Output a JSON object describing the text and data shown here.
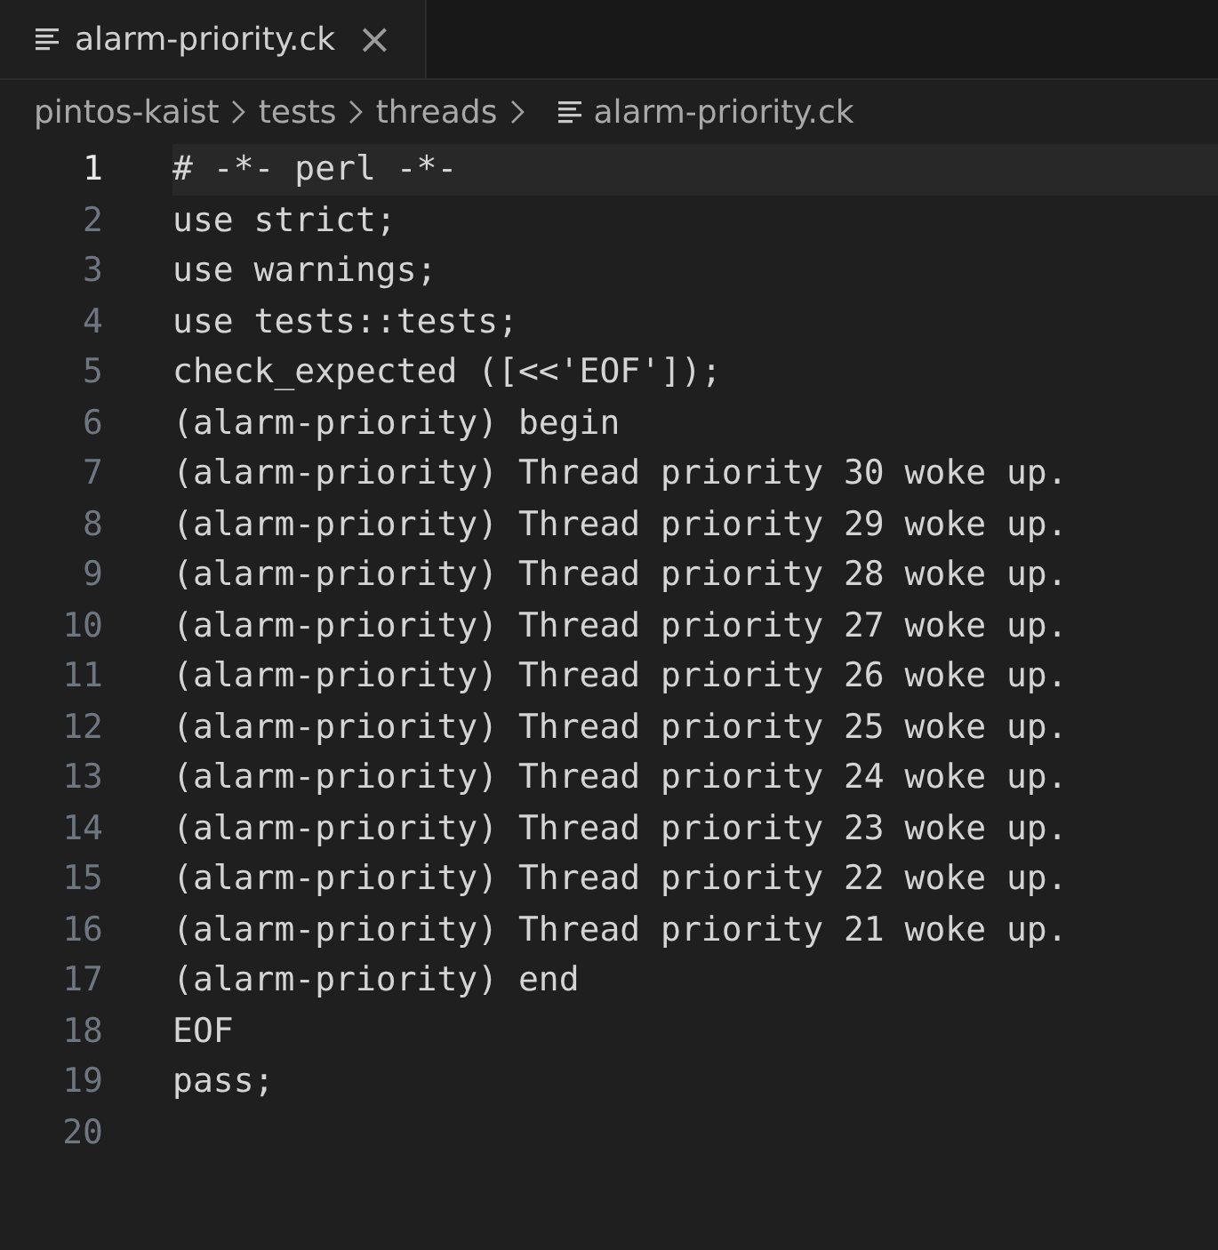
{
  "tabs": [
    {
      "label": "alarm-priority.ck",
      "close": "×",
      "selected": true
    }
  ],
  "breadcrumb": {
    "segments": [
      "pintos-kaist",
      "tests",
      "threads"
    ],
    "file": "alarm-priority.ck"
  },
  "lines": [
    {
      "number": "1",
      "code": "# -*- perl -*-",
      "selected": true
    },
    {
      "number": "2",
      "code": "use strict;",
      "selected": false
    },
    {
      "number": "3",
      "code": "use warnings;",
      "selected": false
    },
    {
      "number": "4",
      "code": "use tests::tests;",
      "selected": false
    },
    {
      "number": "5",
      "code": "check_expected ([<<'EOF']);",
      "selected": false
    },
    {
      "number": "6",
      "code": "(alarm-priority) begin",
      "selected": false
    },
    {
      "number": "7",
      "code": "(alarm-priority) Thread priority 30 woke up.",
      "selected": false
    },
    {
      "number": "8",
      "code": "(alarm-priority) Thread priority 29 woke up.",
      "selected": false
    },
    {
      "number": "9",
      "code": "(alarm-priority) Thread priority 28 woke up.",
      "selected": false
    },
    {
      "number": "10",
      "code": "(alarm-priority) Thread priority 27 woke up.",
      "selected": false
    },
    {
      "number": "11",
      "code": "(alarm-priority) Thread priority 26 woke up.",
      "selected": false
    },
    {
      "number": "12",
      "code": "(alarm-priority) Thread priority 25 woke up.",
      "selected": false
    },
    {
      "number": "13",
      "code": "(alarm-priority) Thread priority 24 woke up.",
      "selected": false
    },
    {
      "number": "14",
      "code": "(alarm-priority) Thread priority 23 woke up.",
      "selected": false
    },
    {
      "number": "15",
      "code": "(alarm-priority) Thread priority 22 woke up.",
      "selected": false
    },
    {
      "number": "16",
      "code": "(alarm-priority) Thread priority 21 woke up.",
      "selected": false
    },
    {
      "number": "17",
      "code": "(alarm-priority) end",
      "selected": false
    },
    {
      "number": "18",
      "code": "EOF",
      "selected": false
    },
    {
      "number": "19",
      "code": "pass;",
      "selected": false
    },
    {
      "number": "20",
      "selected": false
    }
  ]
}
